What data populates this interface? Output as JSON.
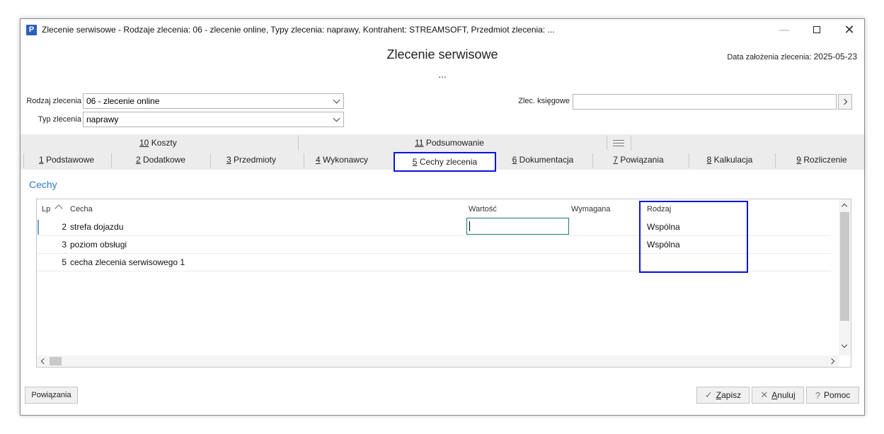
{
  "window": {
    "title": "Zlecenie serwisowe - Rodzaje zlecenia: 06 - zlecenie online, Typy zlecenia: naprawy, Kontrahent: STREAMSOFT, Przedmiot zlecenia: ...",
    "app_icon_letter": "P",
    "minimize_glyph": "—",
    "close_glyph": "✕"
  },
  "header": {
    "title": "Zlecenie serwisowe",
    "subtitle": "...",
    "date_label": "Data założenia zlecenia:",
    "date_value": "2025-05-23"
  },
  "form": {
    "rodzaj_label": "Rodzaj zlecenia",
    "rodzaj_value": "06 - zlecenie online",
    "typ_label": "Typ zlecenia",
    "typ_value": "naprawy",
    "ledger_label": "Zlec. księgowe",
    "ledger_value": ""
  },
  "tabs": {
    "row1": [
      {
        "num": "10",
        "label": " Koszty"
      },
      {
        "num": "11",
        "label": " Podsumowanie"
      }
    ],
    "row2": [
      {
        "num": "1",
        "label": " Podstawowe"
      },
      {
        "num": "2",
        "label": " Dodatkowe"
      },
      {
        "num": "3",
        "label": " Przedmioty"
      },
      {
        "num": "4",
        "label": " Wykonawcy"
      },
      {
        "num": "5",
        "label": " Cechy zlecenia"
      },
      {
        "num": "6",
        "label": " Dokumentacja"
      },
      {
        "num": "7",
        "label": " Powiązania"
      },
      {
        "num": "8",
        "label": " Kalkulacja"
      },
      {
        "num": "9",
        "label": " Rozliczenie"
      }
    ],
    "active": "5 Cechy zlecenia"
  },
  "section": {
    "title": "Cechy"
  },
  "grid": {
    "columns": {
      "lp": "Lp",
      "cecha": "Cecha",
      "wartosc": "Wartość",
      "wymagana": "Wymagana",
      "rodzaj": "Rodzaj"
    },
    "rows": [
      {
        "lp": "2",
        "cecha": "strefa dojazdu",
        "wartosc": "",
        "wymagana": "",
        "rodzaj": "Wspólna"
      },
      {
        "lp": "3",
        "cecha": "poziom obsługi",
        "wartosc": "",
        "wymagana": "",
        "rodzaj": "Wspólna"
      },
      {
        "lp": "5",
        "cecha": "cecha zlecenia serwisowego 1",
        "wartosc": "",
        "wymagana": "",
        "rodzaj": ""
      }
    ]
  },
  "buttons": {
    "powiazania": "Powiązania",
    "save_mnemonic": "Z",
    "save_rest": "apisz",
    "cancel_mnemonic": "A",
    "cancel_rest": "nuluj",
    "help": "Pomoc"
  },
  "colors": {
    "highlight_border": "#0a14d8",
    "section_title": "#2f7bc8",
    "app_icon": "#2b5eb8"
  }
}
